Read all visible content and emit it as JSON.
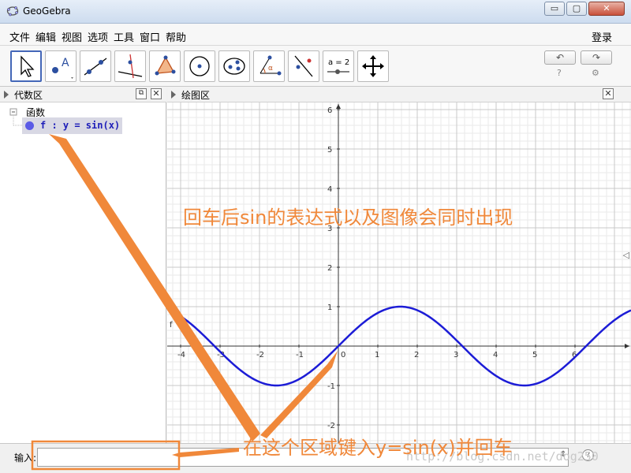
{
  "window": {
    "title": "GeoGebra",
    "minimize": "▭",
    "maximize": "▢",
    "close": "✕"
  },
  "menubar": {
    "items": [
      "文件",
      "编辑",
      "视图",
      "选项",
      "工具",
      "窗口",
      "帮助"
    ],
    "login": "登录"
  },
  "toolbar": {
    "tools": [
      "move-tool",
      "point-tool",
      "line-tool",
      "perpendicular-tool",
      "polygon-tool",
      "circle-tool",
      "conic-tool",
      "angle-tool",
      "reflect-tool",
      "slider-tool",
      "move-graphics-tool"
    ],
    "slider_label": "a = 2",
    "undo": "↶",
    "redo": "↷",
    "help_icon": "?",
    "settings_icon": "⚙"
  },
  "algebra": {
    "header": "代数区",
    "category": "函数",
    "function_entry": "f : y = sin(x)",
    "function_color": "#5a5ae6"
  },
  "graphics": {
    "header": "绘图区",
    "x_ticks": [
      "-4",
      "-3",
      "-2",
      "-1",
      "0",
      "1",
      "2",
      "3",
      "4",
      "5",
      "6"
    ],
    "y_ticks": [
      "-2",
      "-1",
      "1",
      "2",
      "3",
      "4",
      "5",
      "6"
    ],
    "curve_color": "#1c1cd6"
  },
  "annotations": {
    "top_note": "回车后sin的表达式以及图像会同时出现",
    "bottom_note": "在这个区域键入y=sin(x)并回车",
    "color": "#f0883a"
  },
  "inputbar": {
    "label": "输入:",
    "value": "",
    "help_icon": "?"
  },
  "watermark": "http://blog.csdn.net/dog250"
}
